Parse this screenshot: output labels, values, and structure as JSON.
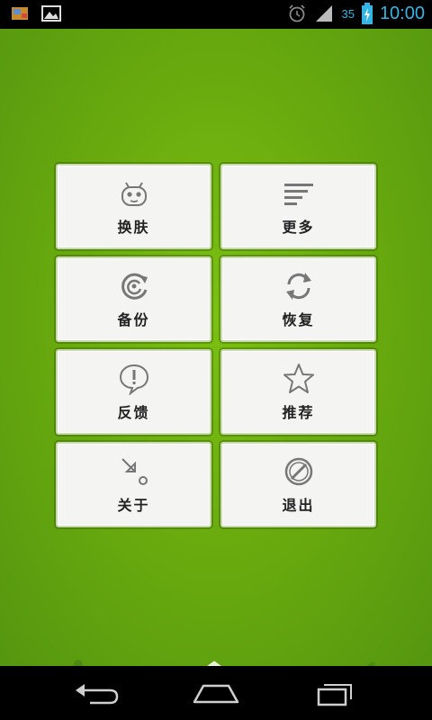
{
  "status_bar": {
    "time": "10:00",
    "battery_level": "35",
    "icons": [
      "notification-app-icon",
      "notification-image-icon",
      "alarm-icon",
      "signal-icon",
      "battery-charging-icon"
    ]
  },
  "menu": {
    "items": [
      {
        "label": "换肤",
        "icon": "skin-icon"
      },
      {
        "label": "更多",
        "icon": "more-lines-icon"
      },
      {
        "label": "备份",
        "icon": "backup-icon"
      },
      {
        "label": "恢复",
        "icon": "restore-icon"
      },
      {
        "label": "反馈",
        "icon": "feedback-icon"
      },
      {
        "label": "推荐",
        "icon": "star-icon"
      },
      {
        "label": "关于",
        "icon": "about-icon"
      },
      {
        "label": "退出",
        "icon": "exit-icon"
      }
    ]
  },
  "toolbar": {
    "icons": [
      "share-icon",
      "home-icon",
      "clean-icon"
    ]
  },
  "nav_bar": {
    "icons": [
      "back-icon",
      "home-outline-icon",
      "recent-apps-icon"
    ]
  },
  "colors": {
    "background_green": "#6aac0e",
    "tile_background": "#f4f4f2",
    "status_accent": "#33b5e5"
  }
}
